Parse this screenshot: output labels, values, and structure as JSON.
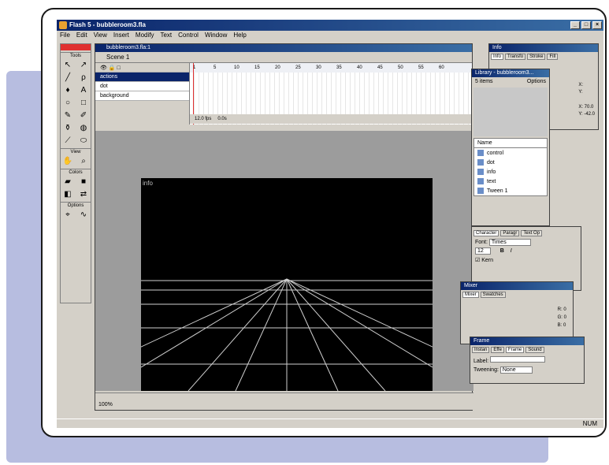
{
  "app": {
    "title": "Flash 5 - bubbleroom3.fla",
    "menus": [
      "File",
      "Edit",
      "View",
      "Insert",
      "Modify",
      "Text",
      "Control",
      "Window",
      "Help"
    ],
    "status": "NUM"
  },
  "document": {
    "title": "bubbleroom3.fla:1",
    "scene": "Scene 1",
    "zoom": "100%",
    "stage_label": "info",
    "layers": [
      {
        "name": "actions",
        "selected": true
      },
      {
        "name": "dot",
        "selected": false
      },
      {
        "name": "background",
        "selected": false
      }
    ],
    "ruler": [
      "1",
      "5",
      "10",
      "15",
      "20",
      "25",
      "30",
      "35",
      "40",
      "45",
      "50",
      "55",
      "60"
    ],
    "fps": "12.0 fps",
    "time": "0.0s"
  },
  "toolbox": {
    "title": "Tools",
    "sections": {
      "view": "View",
      "colors": "Colors",
      "options": "Options"
    }
  },
  "info_panel": {
    "title": "Info",
    "tabs": [
      "Info",
      "Transfo",
      "Stroke",
      "Fill"
    ],
    "x": "X:",
    "y": "Y:",
    "coord_x": "X: 70.0",
    "coord_y": "Y: -42.0"
  },
  "library_panel": {
    "title": "Library - bubbleroom3...",
    "count": "5 items",
    "options": "Options",
    "header": "Name",
    "items": [
      "control",
      "dot",
      "info",
      "text",
      "Tween 1"
    ]
  },
  "character_panel": {
    "tabs": [
      "Character",
      "Paragr",
      "Text Op"
    ],
    "font_label": "Font:",
    "font": "Times",
    "size": "12",
    "kern": "Kern"
  },
  "mixer_panel": {
    "title": "Mixer",
    "tabs": [
      "Mixer",
      "Swatches"
    ],
    "r": "R:",
    "g": "G:",
    "b": "B:",
    "r_value": "0",
    "g_value": "0",
    "b_value": "0"
  },
  "frame_panel": {
    "title": "Frame",
    "tabs": [
      "Instan",
      "Effe",
      "Frame",
      "Sound"
    ],
    "label": "Label:",
    "tweening": "Tweening:",
    "tweening_value": "None"
  }
}
